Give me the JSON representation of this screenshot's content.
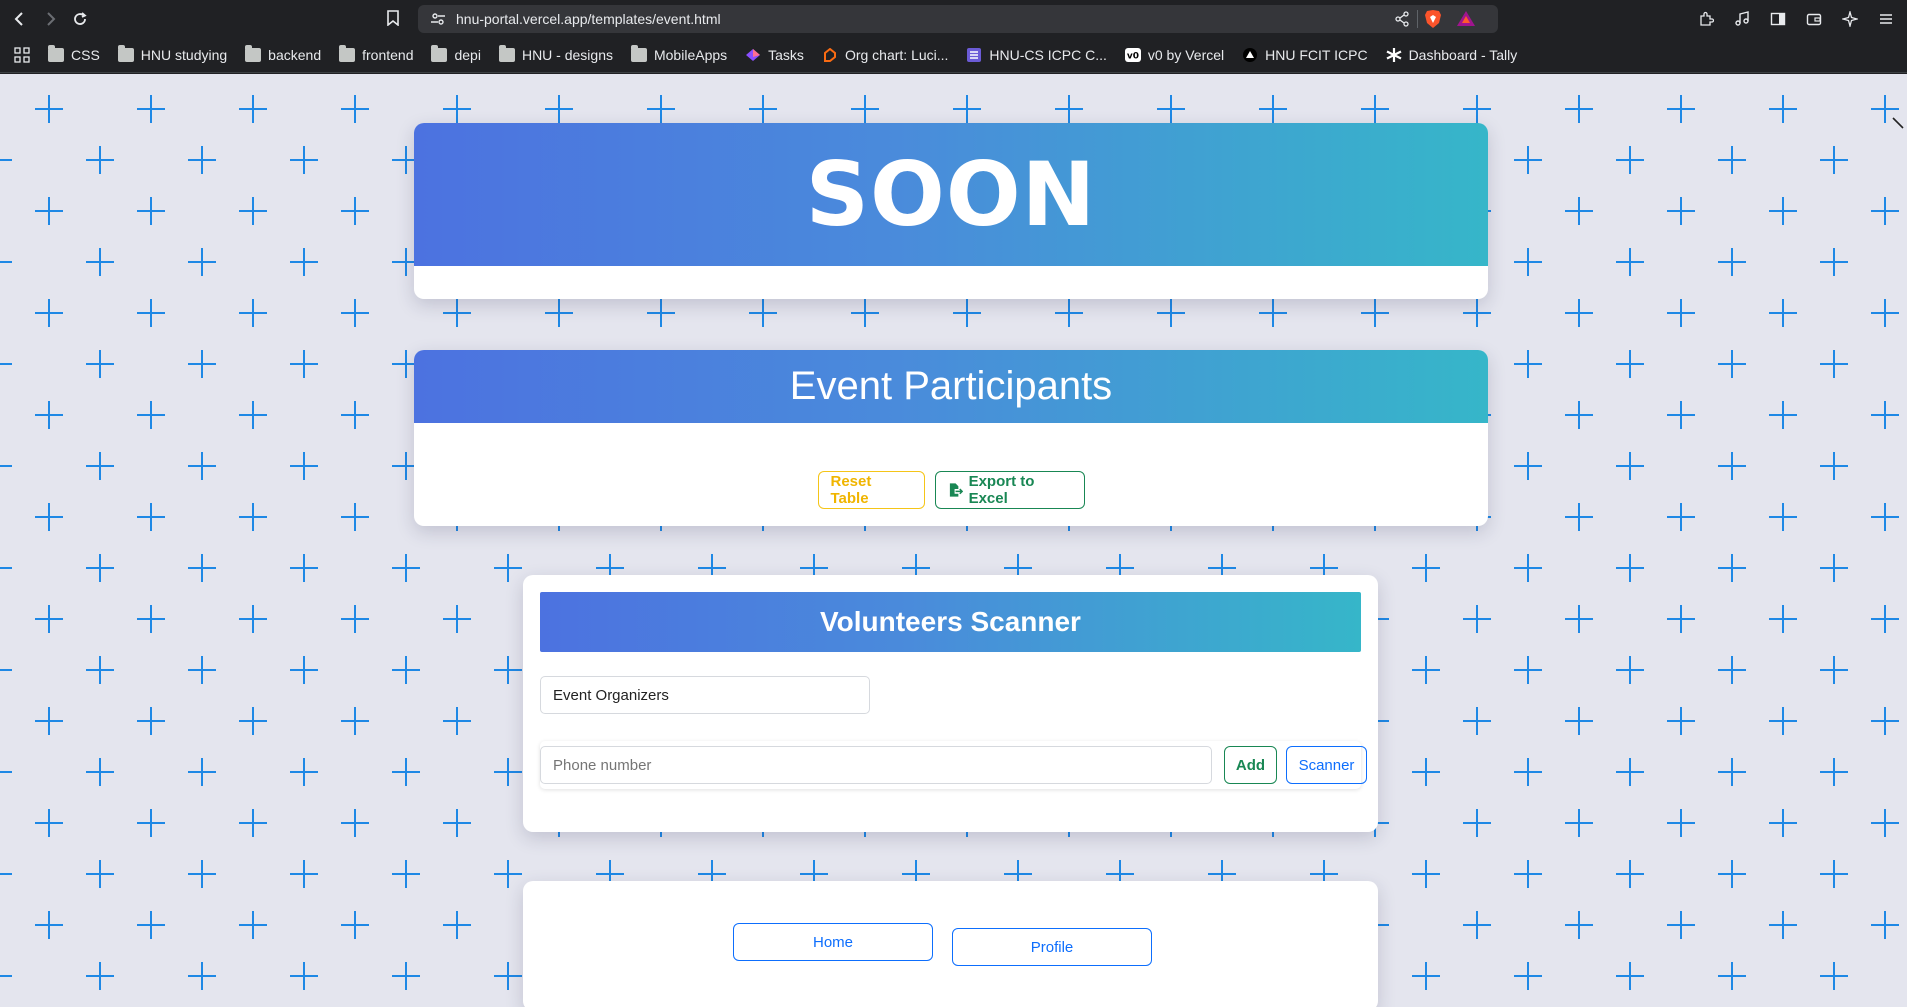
{
  "browser": {
    "url": "hnu-portal.vercel.app/templates/event.html",
    "bookmarks": [
      {
        "label": "CSS",
        "type": "folder"
      },
      {
        "label": "HNU studying",
        "type": "folder"
      },
      {
        "label": "backend",
        "type": "folder"
      },
      {
        "label": "frontend",
        "type": "folder"
      },
      {
        "label": "depi",
        "type": "folder"
      },
      {
        "label": "HNU - designs",
        "type": "folder"
      },
      {
        "label": "MobileApps",
        "type": "folder"
      },
      {
        "label": "Tasks",
        "type": "link"
      },
      {
        "label": "Org chart: Luci...",
        "type": "link"
      },
      {
        "label": "HNU-CS ICPC C...",
        "type": "link"
      },
      {
        "label": "v0 by Vercel",
        "type": "link"
      },
      {
        "label": "HNU FCIT ICPC",
        "type": "link"
      },
      {
        "label": "Dashboard - Tally",
        "type": "link"
      }
    ]
  },
  "colors": {
    "accent_start": "#4c72e0",
    "accent_end": "#36b6c9",
    "pattern": "#1e88e5",
    "page_bg": "#e4e5ee",
    "warning": "#f0b500",
    "success": "#198754",
    "primary": "#0d6efd"
  },
  "soon_card": {
    "title": "SOON"
  },
  "participants_card": {
    "title": "Event Participants",
    "reset_label": "Reset Table",
    "export_label": "Export to Excel"
  },
  "scanner_card": {
    "title": "Volunteers Scanner",
    "selected_group": "Event Organizers",
    "phone_placeholder": "Phone number",
    "add_label": "Add",
    "scanner_label": "Scanner"
  },
  "nav_card": {
    "home_label": "Home",
    "profile_label": "Profile"
  }
}
